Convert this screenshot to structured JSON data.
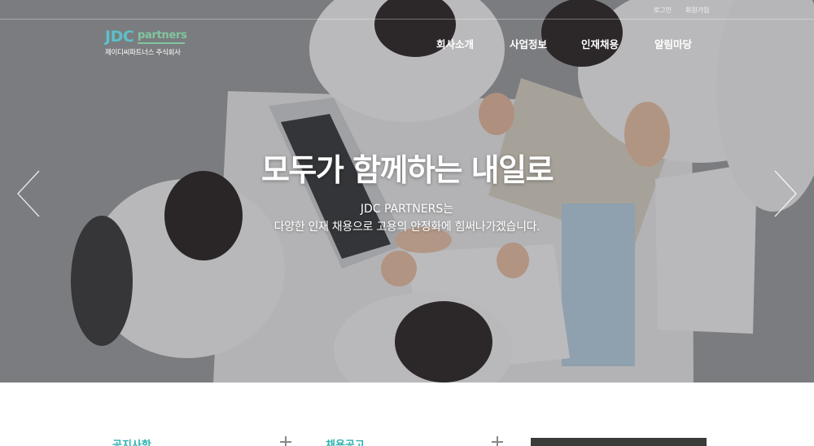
{
  "utility": {
    "login": "로그인",
    "join": "회원가입"
  },
  "logo": {
    "mark": "JDC",
    "word": "partners",
    "subtitle": "제이디씨파트너스 주식회사"
  },
  "nav": {
    "items": [
      "회사소개",
      "사업정보",
      "인재채용",
      "알림마당"
    ]
  },
  "hero": {
    "headline": "모두가 함께하는 내일로",
    "line1": "JDC PARTNERS는",
    "line2": "다양한 인재 채용으로 고용의 안정화에 힘써나가겠습니다."
  },
  "sections": {
    "notice": "공지사항",
    "recruit": "채용공고"
  },
  "colors": {
    "accent": "#2fb3b0",
    "logo_blue": "#5cc0c8",
    "logo_green": "#7fc6a0"
  },
  "icons": {
    "prev": "chevron-left-icon",
    "next": "chevron-right-icon",
    "more": "plus-icon"
  }
}
